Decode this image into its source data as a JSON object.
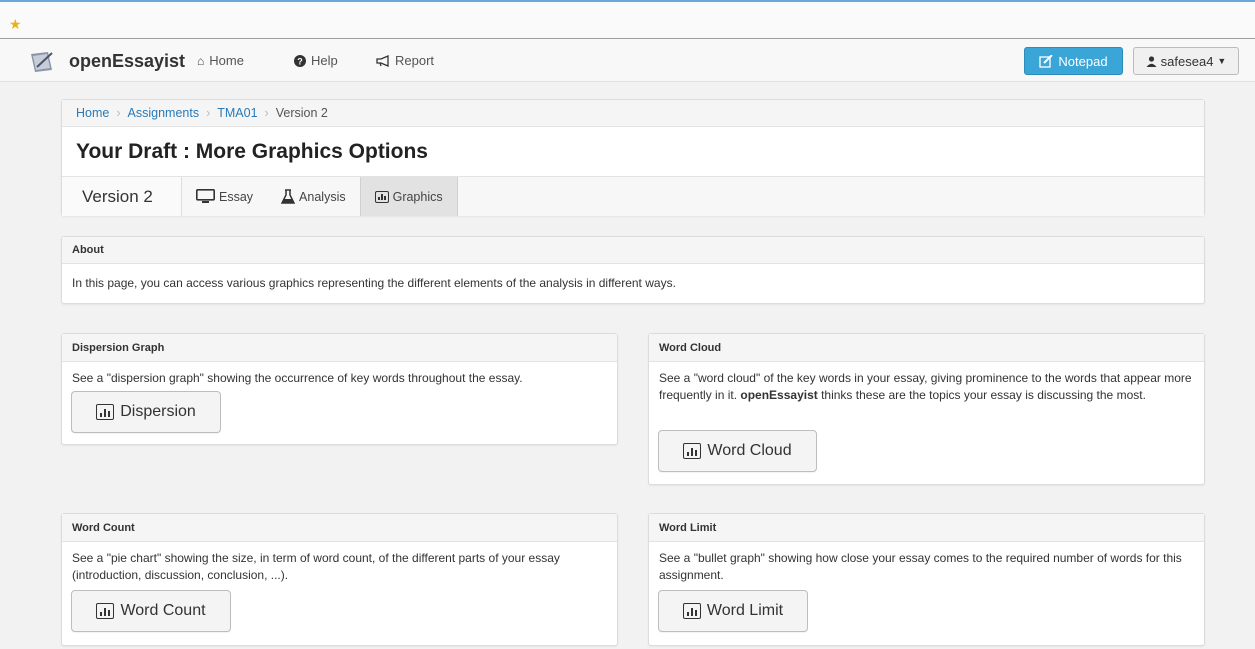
{
  "nav": {
    "brand": "openEssayist",
    "home": "Home",
    "help": "Help",
    "report": "Report",
    "notepad": "Notepad",
    "user": "safesea4"
  },
  "breadcrumb": {
    "home": "Home",
    "assignments": "Assignments",
    "tma": "TMA01",
    "current": "Version 2"
  },
  "page": {
    "title": "Your Draft : More Graphics Options",
    "version_label": "Version 2",
    "tabs": {
      "essay": "Essay",
      "analysis": "Analysis",
      "graphics": "Graphics"
    }
  },
  "about": {
    "heading": "About",
    "text": "In this page, you can access various graphics representing the different elements of the analysis in different ways."
  },
  "dispersion": {
    "heading": "Dispersion Graph",
    "text": "See a \"dispersion graph\" showing the occurrence of key words throughout the essay.",
    "button": "Dispersion"
  },
  "wordcloud": {
    "heading": "Word Cloud",
    "text_before": "See a \"word cloud\" of the key words in your essay, giving prominence to the words that appear more frequently in it. ",
    "text_bold": "openEssayist",
    "text_after": " thinks these are the topics your essay is discussing the most.",
    "button": "Word Cloud"
  },
  "wordcount": {
    "heading": "Word Count",
    "text": "See a \"pie chart\" showing the size, in term of word count, of the different parts of your essay (introduction, discussion, conclusion, ...).",
    "button": "Word Count"
  },
  "wordlimit": {
    "heading": "Word Limit",
    "text": "See a \"bullet graph\" showing how close your essay comes to the required number of words for this assignment.",
    "button": "Word Limit"
  },
  "colors": {
    "link": "#2a7ab9",
    "notepad": "#39a6d7"
  }
}
